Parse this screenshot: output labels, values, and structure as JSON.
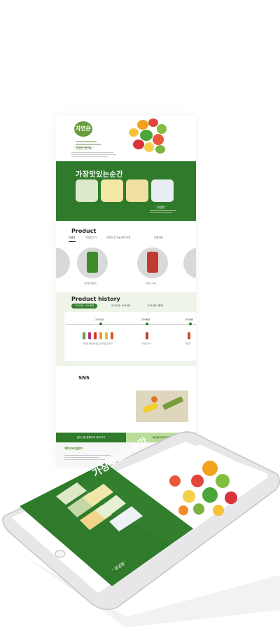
{
  "mockup": {
    "hero_logo": "자연은",
    "hero_quote": "' 맛있는 좋아요 '",
    "green_title": "가장맛있는순간",
    "green_quote": "' 생생한 '",
    "product_title": "Product",
    "product_tabs": [
      "자연은",
      "자연은오가",
      "생자연 유기농/체도자연",
      "전통제비"
    ],
    "product_labels": [
      "자연은 알로에",
      "자연은 사과"
    ],
    "history_title": "Product history",
    "history_tabs": [
      "2004년~2008년",
      "2012년~2019년",
      "2013년~현재"
    ],
    "history_years": [
      "2004년",
      "2006년",
      "2008년"
    ],
    "history_captions": [
      "자연은 알로에/포도/토마토/오렌지",
      "자연은사과",
      "자연은"
    ],
    "sns_title": "SNS",
    "footer_buttons": [
      "웅진식품 홈페이지 바로가기",
      "웅진몰 바로가기"
    ],
    "footer_logo": "Woongjin",
    "footer_copy": "Copyright 2023"
  },
  "tablet": {
    "title": "가장맛있는순간",
    "quote": "' 생생함 '"
  },
  "colors": {
    "brand_green": "#2f7a2b",
    "light_green": "#eef4e8",
    "button_light_green": "#b9dd98"
  }
}
